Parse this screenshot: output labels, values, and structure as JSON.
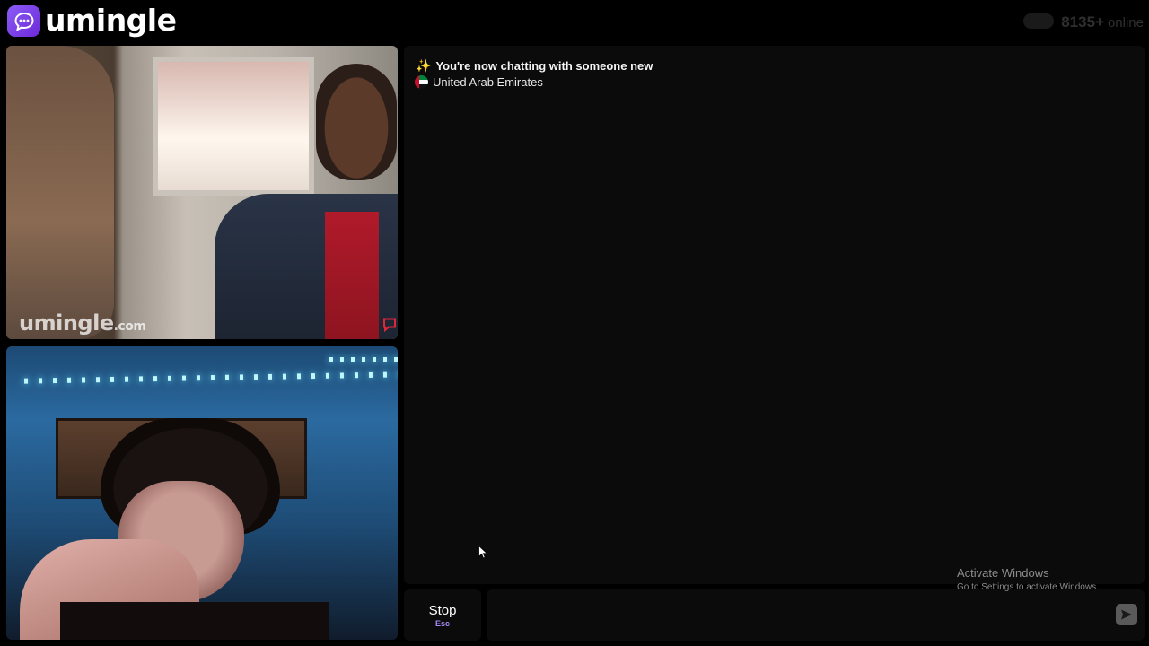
{
  "header": {
    "logo_text": "umingle",
    "online_count": "8135+",
    "online_label": "online"
  },
  "remote_video": {
    "watermark_main": "umingle",
    "watermark_suffix": ".com"
  },
  "chat": {
    "status_message": "You're now chatting with someone new",
    "country": "United Arab Emirates"
  },
  "controls": {
    "stop_label": "Stop",
    "stop_shortcut": "Esc",
    "message_placeholder": ""
  },
  "windows_notice": {
    "title": "Activate Windows",
    "subtitle": "Go to Settings to activate Windows."
  },
  "colors": {
    "accent": "#8b5cf6",
    "shortcut": "#a78bfa",
    "panel": "#0b0b0b",
    "background": "#000000"
  }
}
